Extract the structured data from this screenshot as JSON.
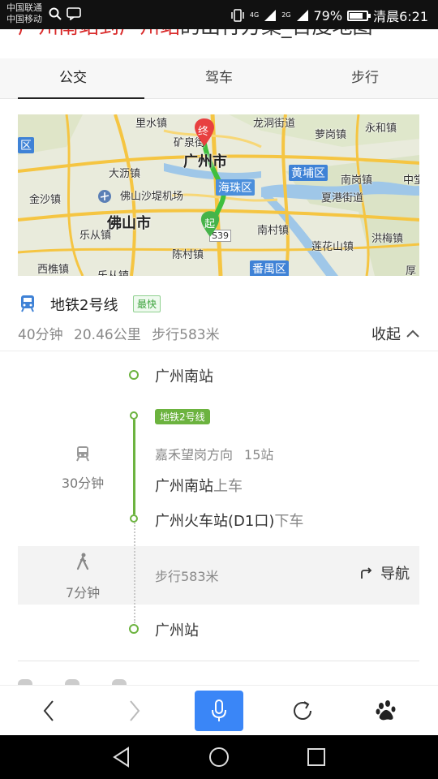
{
  "status_bar": {
    "carrier_1": "中国联通",
    "carrier_2": "中国移动",
    "net_1": "4G",
    "net_2": "2G",
    "battery": "79%",
    "battery_level": 0.79,
    "time": "清晨6:21"
  },
  "page": {
    "title_red_1": "广州南站到",
    "title_red_2": "广州站",
    "title_rest": "的出行方案_百度地图"
  },
  "tabs": [
    {
      "label": "公交",
      "active": true
    },
    {
      "label": "驾车",
      "active": false
    },
    {
      "label": "步行",
      "active": false
    }
  ],
  "map": {
    "labels": {
      "l1": "龙洞街道",
      "l2": "永和镇",
      "l3": "萝岗镇",
      "l4": "广州市",
      "l5": "海珠区",
      "l6": "黄埔区",
      "l7": "南岗镇",
      "l8": "夏港街道",
      "l9": "大沥镇",
      "l10": "佛山沙堤机场",
      "l11": "金沙镇",
      "l12": "佛山市",
      "l13": "南村镇",
      "l14": "洪梅镇",
      "l15": "莲花山镇",
      "l16": "西樵镇",
      "l17": "乐从镇",
      "l18": "陈村镇",
      "l19": "番禺区",
      "l20": "中堂",
      "l21": "区",
      "l22": "里水镇",
      "l23": "矿泉街",
      "l24": "S39",
      "l25": "厚"
    },
    "marker_end": "终",
    "marker_start": "起",
    "colors": {
      "route": "#3fbf3f",
      "road": "#f5c542",
      "water": "#9fc7e8",
      "end": "#e84040",
      "start": "#46b34a"
    }
  },
  "route": {
    "name": "地铁2号线",
    "badge": "最快",
    "duration": "40分钟",
    "distance": "20.46公里",
    "walk": "步行583米",
    "collapse_label": "收起"
  },
  "timeline": {
    "origin": "广州南站",
    "line_badge": "地铁2号线",
    "direction": "嘉禾望岗方向",
    "stops": "15站",
    "board_station": "广州南站",
    "board_suffix": "上车",
    "alight_station": "广州火车站(D1口)",
    "alight_suffix": "下车",
    "metro_time": "30分钟",
    "walk_time": "7分钟",
    "walk_text": "步行583米",
    "nav_label": "导航",
    "destination": "广州站",
    "accent": "#6cb33f"
  },
  "toolbar": {
    "mic_color": "#3a86f7"
  }
}
